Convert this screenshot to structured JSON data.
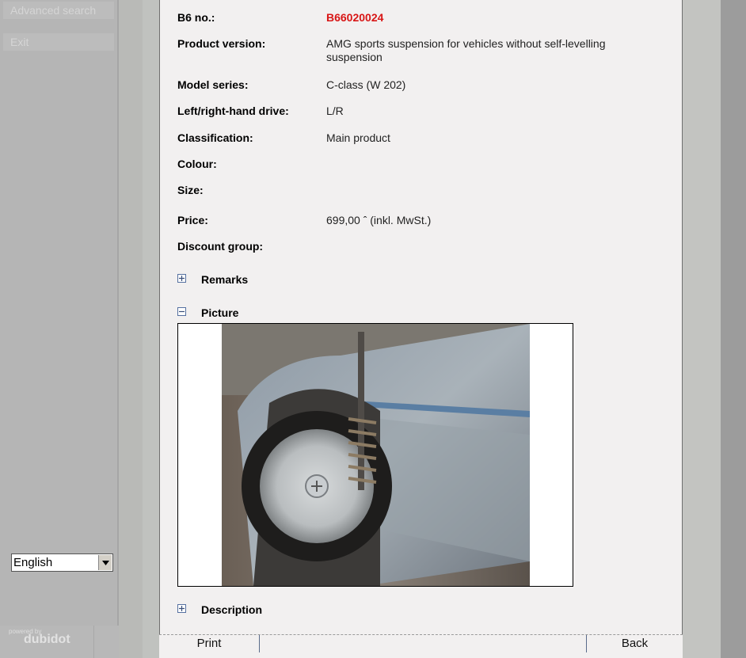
{
  "sidebar": {
    "menu": [
      {
        "label": "Advanced search"
      },
      {
        "label": "Exit"
      }
    ],
    "language": {
      "selected": "English"
    },
    "powered_by": {
      "small": "powered by",
      "brand": "dubidot"
    }
  },
  "details": {
    "b6": {
      "label": "B6 no.:",
      "value": "B66020024"
    },
    "version": {
      "label": "Product version:",
      "value": "AMG sports suspension for vehicles without self-levelling suspension"
    },
    "model": {
      "label": "Model series:",
      "value": "C-class (W 202)"
    },
    "drive": {
      "label": "Left/right-hand drive:",
      "value": "L/R"
    },
    "classification": {
      "label": "Classification:",
      "value": "Main product"
    },
    "colour": {
      "label": "Colour:",
      "value": ""
    },
    "size": {
      "label": "Size:",
      "value": ""
    },
    "price": {
      "label": "Price:",
      "value": "699,00 ˆ (inkl. MwSt.)"
    },
    "discount": {
      "label": "Discount group:",
      "value": ""
    }
  },
  "sections": {
    "remarks": {
      "label": "Remarks",
      "expanded": false
    },
    "picture": {
      "label": "Picture",
      "expanded": true
    },
    "description": {
      "label": "Description",
      "expanded": false
    }
  },
  "footer": {
    "print": "Print",
    "back": "Back"
  },
  "colors": {
    "accent_red": "#d81616",
    "panel_bg": "#f2f0f0",
    "sidebar_bg": "#b5b5b5"
  }
}
